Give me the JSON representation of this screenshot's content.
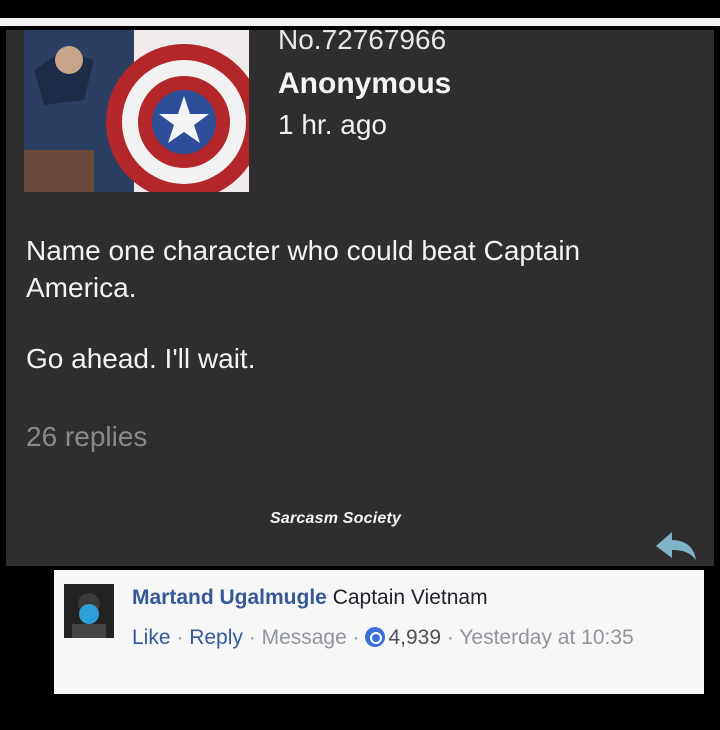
{
  "post": {
    "number": "No.72767966",
    "author": "Anonymous",
    "time": "1 hr. ago",
    "body_line1": "Name one character who could beat Captain America.",
    "body_line2": "Go ahead. I'll wait.",
    "replies": "26 replies",
    "watermark": "Sarcasm Society"
  },
  "comment": {
    "name": "Martand Ugalmugle",
    "text": "Captain Vietnam",
    "like": "Like",
    "reply": "Reply",
    "message": "Message",
    "like_count": "4,939",
    "timestamp": "Yesterday at 10:35"
  },
  "colors": {
    "card_bg": "#2e2e2f",
    "link_blue": "#365899",
    "reply_arrow": "#7fb3c6"
  },
  "icons": [
    "captain-america-thumbnail",
    "reply-arrow-icon",
    "like-icon",
    "commenter-avatar"
  ]
}
